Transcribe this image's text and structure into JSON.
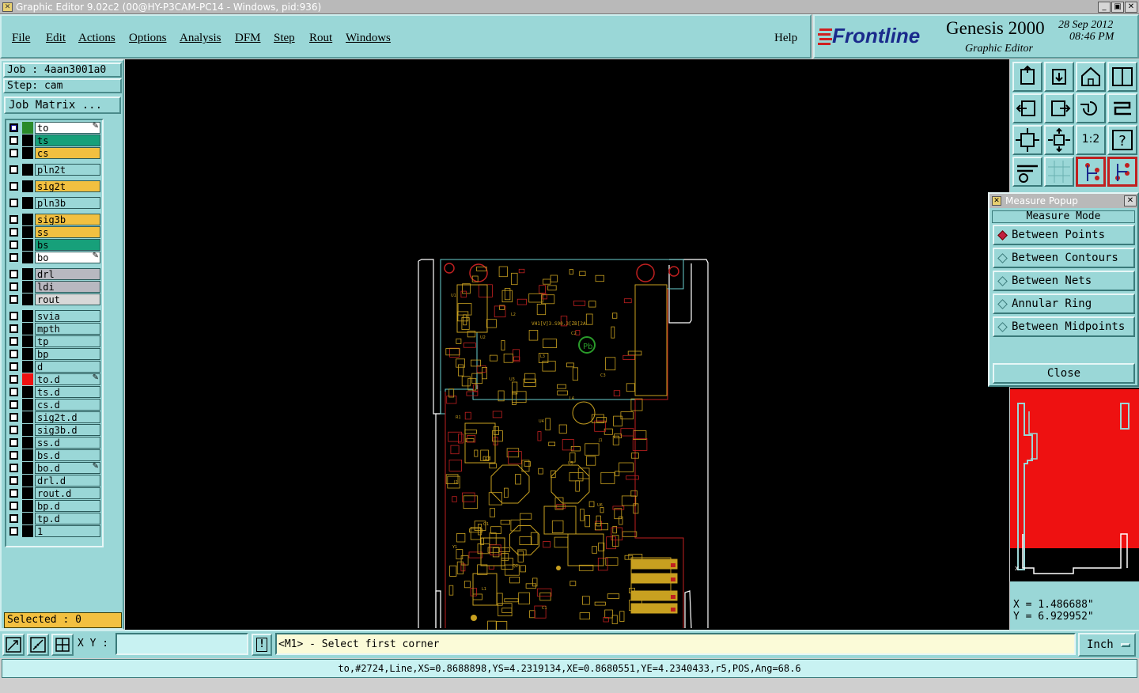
{
  "window": {
    "title": "Graphic Editor 9.02c2 (00@HY-P3CAM-PC14 - Windows, pid:936)",
    "buttons": [
      "_",
      "▣",
      "✕"
    ]
  },
  "menu": {
    "items": [
      {
        "label": "File"
      },
      {
        "label": "Edit"
      },
      {
        "label": "Actions"
      },
      {
        "label": "Options"
      },
      {
        "label": "Analysis"
      },
      {
        "label": "DFM"
      },
      {
        "label": "Step"
      },
      {
        "label": "Rout"
      },
      {
        "label": "Windows"
      }
    ],
    "help": "Help"
  },
  "brand": {
    "logo": "Frontline",
    "product": "Genesis 2000",
    "subtitle": "Graphic Editor",
    "date": "28 Sep 2012",
    "time": "08:46 PM"
  },
  "job": {
    "job_label": "Job : 4aan3001a0",
    "step_label": "Step: cam",
    "matrix_button": "Job Matrix ..."
  },
  "layers": [
    {
      "name": "to",
      "color": "#ffffff",
      "swatch": "#2a8a2a",
      "cb": "#1a1a9a",
      "edit": true
    },
    {
      "name": "ts",
      "color": "#17a07a",
      "swatch": "#000000"
    },
    {
      "name": "cs",
      "color": "#f2c040",
      "swatch": "#000000"
    },
    {
      "name": "pln2t",
      "color": "#9ad7d7",
      "swatch": "#000000",
      "gap": true
    },
    {
      "name": "sig2t",
      "color": "#f2c040",
      "swatch": "#000000",
      "gap": true
    },
    {
      "name": "pln3b",
      "color": "#9ad7d7",
      "swatch": "#000000",
      "gap": true
    },
    {
      "name": "sig3b",
      "color": "#f2c040",
      "swatch": "#000000",
      "gap": true
    },
    {
      "name": "ss",
      "color": "#f2c040",
      "swatch": "#000000"
    },
    {
      "name": "bs",
      "color": "#17a07a",
      "swatch": "#000000"
    },
    {
      "name": "bo",
      "color": "#ffffff",
      "swatch": "#000000",
      "edit": true
    },
    {
      "name": "drl",
      "color": "#b8b8c0",
      "swatch": "#000000",
      "gap": true
    },
    {
      "name": "ldi",
      "color": "#b8b8c0",
      "swatch": "#000000"
    },
    {
      "name": "rout",
      "color": "#d8d8d8",
      "swatch": "#000000"
    },
    {
      "name": "svia",
      "color": "#9ad7d7",
      "swatch": "#000000",
      "gap": true
    },
    {
      "name": "mpth",
      "color": "#9ad7d7",
      "swatch": "#000000"
    },
    {
      "name": "tp",
      "color": "#9ad7d7",
      "swatch": "#000000"
    },
    {
      "name": "bp",
      "color": "#9ad7d7",
      "swatch": "#000000"
    },
    {
      "name": "d",
      "color": "#9ad7d7",
      "swatch": "#000000"
    },
    {
      "name": "to.d",
      "color": "#9ad7d7",
      "swatch": "#ee1111",
      "edit": true
    },
    {
      "name": "ts.d",
      "color": "#9ad7d7",
      "swatch": "#000000"
    },
    {
      "name": "cs.d",
      "color": "#9ad7d7",
      "swatch": "#000000"
    },
    {
      "name": "sig2t.d",
      "color": "#9ad7d7",
      "swatch": "#000000"
    },
    {
      "name": "sig3b.d",
      "color": "#9ad7d7",
      "swatch": "#000000"
    },
    {
      "name": "ss.d",
      "color": "#9ad7d7",
      "swatch": "#000000"
    },
    {
      "name": "bs.d",
      "color": "#9ad7d7",
      "swatch": "#000000"
    },
    {
      "name": "bo.d",
      "color": "#9ad7d7",
      "swatch": "#000000",
      "edit": true
    },
    {
      "name": "drl.d",
      "color": "#9ad7d7",
      "swatch": "#000000"
    },
    {
      "name": "rout.d",
      "color": "#9ad7d7",
      "swatch": "#000000"
    },
    {
      "name": "bp.d",
      "color": "#9ad7d7",
      "swatch": "#000000"
    },
    {
      "name": "tp.d",
      "color": "#9ad7d7",
      "swatch": "#000000"
    },
    {
      "name": "1",
      "color": "#9ad7d7",
      "swatch": "#000000"
    }
  ],
  "selected": "Selected : 0",
  "toolbar_icons": [
    "upload-step-icon",
    "download-step-icon",
    "home-icon",
    "window-split-icon",
    "exit-left-icon",
    "enter-right-icon",
    "undo-icon",
    "redraw-icon",
    "zoom-fit-icon",
    "zoom-center-icon",
    "zoom-1-2-icon",
    "help-icon",
    "tools-icon",
    "grid-icon",
    "net-view-icon",
    "net-select-icon"
  ],
  "zoom_label": "1:2",
  "measure_popup": {
    "title": "Measure Popup",
    "mode_label": "Measure Mode",
    "options": [
      {
        "label": "Between Points",
        "selected": true
      },
      {
        "label": "Between Contours",
        "selected": false
      },
      {
        "label": "Between Nets",
        "selected": false
      },
      {
        "label": "Annular Ring",
        "selected": false
      },
      {
        "label": "Between Midpoints",
        "selected": false
      }
    ],
    "close": "Close"
  },
  "coords": {
    "x": "X = 1.486688\"",
    "y": "Y = 6.929952\""
  },
  "bottom": {
    "xy_label": "X Y :",
    "xy_value": "",
    "prompt": "<M1> - Select first corner",
    "units": "Inch"
  },
  "status": "to,#2724,Line,XS=0.8688898,YS=4.2319134,XE=0.8680551,YE=4.2340433,r5,POS,Ang=68.6",
  "board": {
    "top_label": "VH1[V]3.S90.3[ZB[2A",
    "component_labels": [
      "U1",
      "U2",
      "U3",
      "U4",
      "U5",
      "U6",
      "Y1",
      "L1",
      "L2",
      "L3",
      "L4",
      "J1",
      "J2",
      "Q1",
      "Q2",
      "C1",
      "C2",
      "C3",
      "R1",
      "R2"
    ]
  }
}
